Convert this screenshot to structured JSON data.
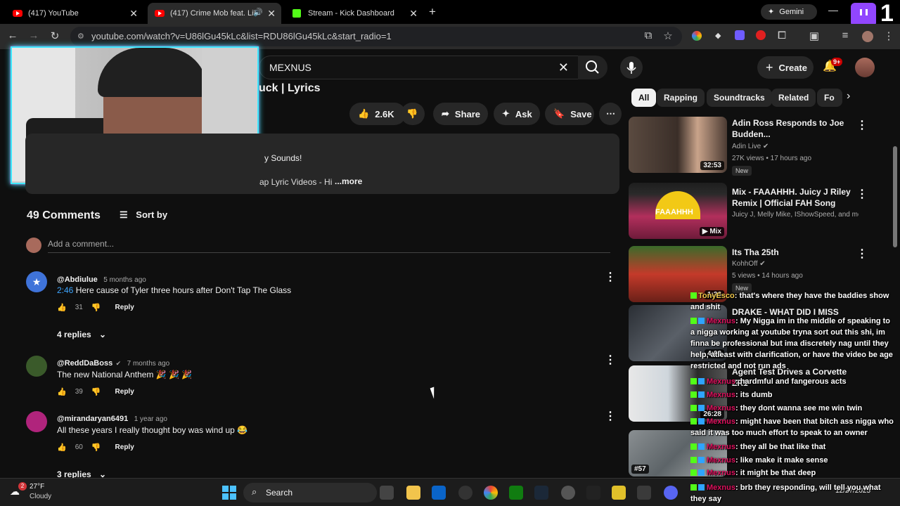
{
  "browser": {
    "tabs": [
      {
        "label": "(417) YouTube"
      },
      {
        "label": "(417) Crime Mob feat. Lil Sc"
      },
      {
        "label": "Stream - Kick Dashboard"
      }
    ],
    "gemini_label": "Gemini",
    "url": "youtube.com/watch?v=U86lGu45kLc&list=RDU86lGu45kLc&start_radio=1"
  },
  "youtube": {
    "search_value": "MEXNUS",
    "create_label": "Create",
    "notif_count": "9+",
    "video_title_fragment": "uck | Lyrics",
    "like_count": "2.6K",
    "share_label": "Share",
    "ask_label": "Ask",
    "save_label": "Save",
    "desc_line1": "y Sounds!",
    "desc_line2": "ap Lyric Videos - Hi",
    "more_label": "...more",
    "chips": [
      "All",
      "Rapping",
      "Soundtracks",
      "Related",
      "Fo"
    ]
  },
  "comments": {
    "count_label": "49 Comments",
    "sort_label": "Sort by",
    "add_placeholder": "Add a comment...",
    "items": [
      {
        "author": "@Abdiulue",
        "time": "5 months ago",
        "timestamp": "2:46",
        "text": "Here cause of Tyler three hours after Don't Tap The Glass",
        "likes": "31",
        "reply": "Reply",
        "replies": "4 replies"
      },
      {
        "author": "@ReddDaBoss",
        "time": "7 months ago",
        "text": "The new National Anthem 🎉 🎉 🎉",
        "likes": "39",
        "reply": "Reply"
      },
      {
        "author": "@mirandaryan6491",
        "time": "1 year ago",
        "text": "All these years I really thought boy was wind up 😂",
        "likes": "60",
        "reply": "Reply",
        "replies": "3 replies"
      }
    ]
  },
  "recommendations": [
    {
      "title": "Adin Ross Responds to Joe Budden...",
      "channel": "Adin Live",
      "meta": "27K views • 17 hours ago",
      "duration": "32:53",
      "badge": "New"
    },
    {
      "title": "Mix - FAAAHHH. Juicy J Riley Remix | Official FAH Song",
      "channel": "Juicy J, Melly Mike, IShowSpeed, and mo...",
      "duration": "Mix",
      "thumb_text": "FAAAHHH"
    },
    {
      "title": "Its Tha 25th",
      "channel": "KohhOff",
      "meta": "5 views • 14 hours ago",
      "duration": "1:36",
      "badge": "New"
    },
    {
      "title": "DRAKE - WHAT DID I MISS",
      "duration": "4:03"
    },
    {
      "title": "Agent Test Drives a Corvette ZR1",
      "duration": "26:28"
    },
    {
      "title": "",
      "duration": "#57"
    }
  ],
  "chat": [
    {
      "user": "TonyEsco",
      "text": ": that's where they have the baddies show and shit"
    },
    {
      "user": "Mexnus",
      "text": ": My Nigga im in the middle of speaking to a nigga working at youtube tryna sort out this shi, im finna be professional but ima discretely nag until they help, atleast with clarification, or have the video be age restricted and not run ads"
    },
    {
      "user": "Mexnus",
      "text": ": hardmful and fangerous acts"
    },
    {
      "user": "Mexnus",
      "text": ": its dumb"
    },
    {
      "user": "Mexnus",
      "text": ": they dont wanna see me win twin"
    },
    {
      "user": "Mexnus",
      "text": ": might have been that bitch ass nigga who said it was too much effort to speak to an owner"
    },
    {
      "user": "Mexnus",
      "text": ": they all be that like that"
    },
    {
      "user": "Mexnus",
      "text": ": like make it make sense"
    },
    {
      "user": "Mexnus",
      "text": ": it might be that deep"
    },
    {
      "user": "Mexnus",
      "text": ": brb they responding, will tell you what they say"
    }
  ],
  "taskbar": {
    "weather_temp": "27°F",
    "weather_desc": "Cloudy",
    "weather_badge": "2",
    "search_label": "Search",
    "date": "12/27/2025"
  },
  "colors": {
    "bg": "#0f0f0f",
    "yt_red": "#ff0000",
    "kick_green": "#53fc18",
    "chat_user": "#e0115f",
    "webcam_glow": "#3ee8ff"
  }
}
